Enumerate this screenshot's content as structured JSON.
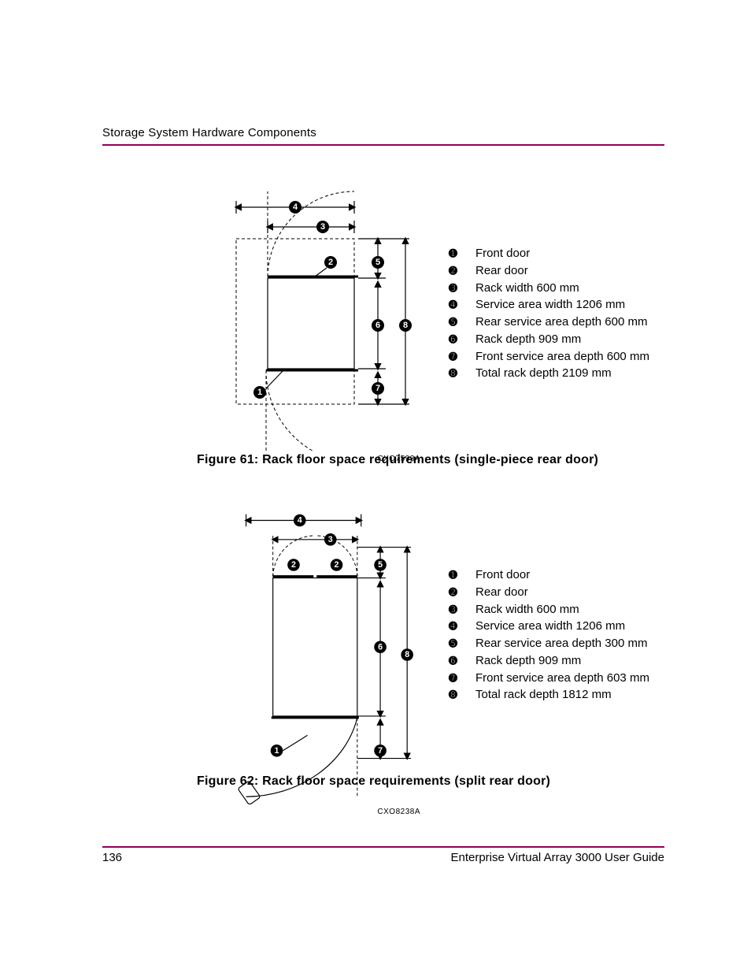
{
  "header": {
    "title": "Storage System Hardware Components"
  },
  "figures": [
    {
      "code": "CXO7593A",
      "caption": "Figure 61:  Rack floor space requirements (single-piece rear door)",
      "legend": [
        {
          "n": "1",
          "label": "Front door"
        },
        {
          "n": "2",
          "label": "Rear door"
        },
        {
          "n": "3",
          "label": "Rack width 600 mm"
        },
        {
          "n": "4",
          "label": "Service area width 1206 mm"
        },
        {
          "n": "5",
          "label": "Rear service area depth 600 mm"
        },
        {
          "n": "6",
          "label": "Rack depth 909 mm"
        },
        {
          "n": "7",
          "label": "Front service area depth 600 mm"
        },
        {
          "n": "8",
          "label": "Total rack depth 2109 mm"
        }
      ]
    },
    {
      "code": "CXO8238A",
      "caption": "Figure 62:  Rack floor space requirements (split rear door)",
      "legend": [
        {
          "n": "1",
          "label": "Front door"
        },
        {
          "n": "2",
          "label": "Rear door"
        },
        {
          "n": "3",
          "label": "Rack width 600 mm"
        },
        {
          "n": "4",
          "label": "Service area width 1206 mm"
        },
        {
          "n": "5",
          "label": "Rear service area depth 300 mm"
        },
        {
          "n": "6",
          "label": "Rack depth 909 mm"
        },
        {
          "n": "7",
          "label": "Front service area depth 603 mm"
        },
        {
          "n": "8",
          "label": "Total rack depth 1812 mm"
        }
      ]
    }
  ],
  "footer": {
    "page": "136",
    "doc": "Enterprise Virtual Array 3000 User Guide"
  },
  "glyph": {
    "1": "➊",
    "2": "➋",
    "3": "➌",
    "4": "➍",
    "5": "➎",
    "6": "➏",
    "7": "➐",
    "8": "➑"
  }
}
